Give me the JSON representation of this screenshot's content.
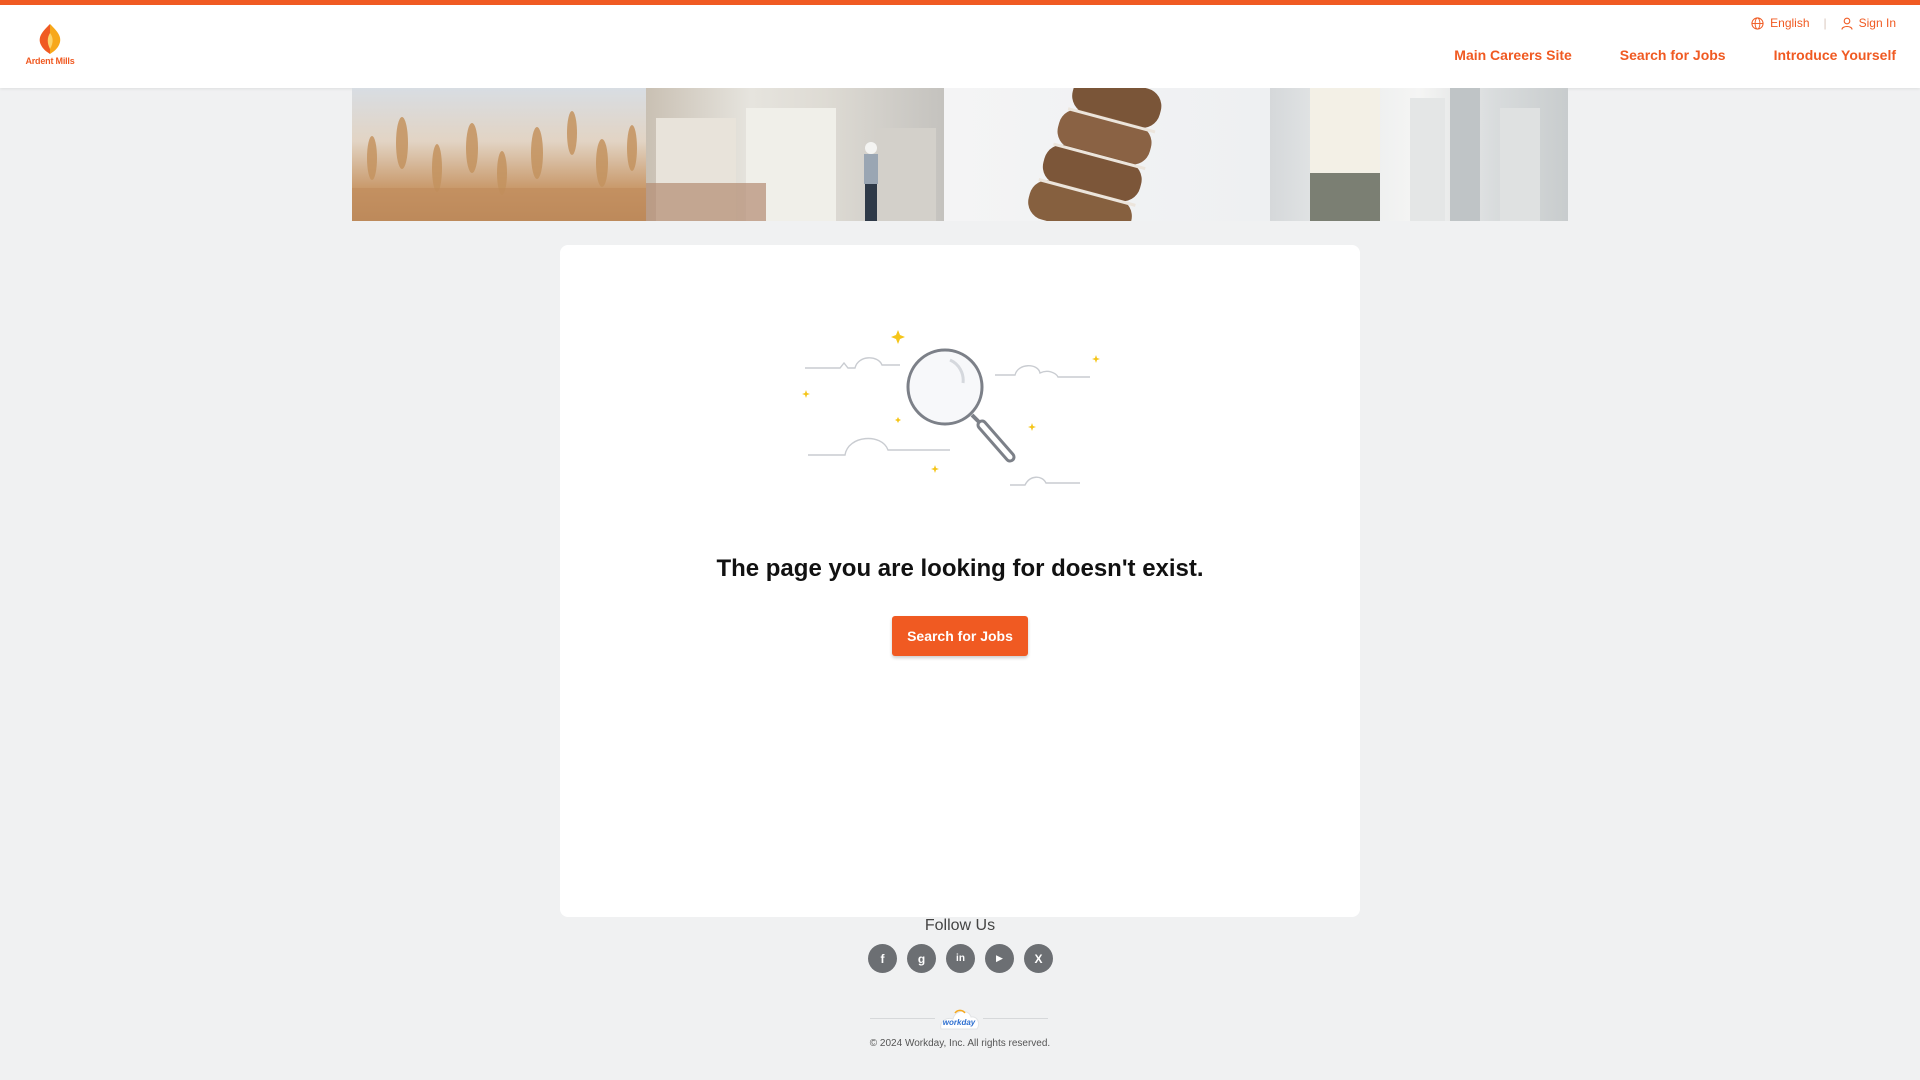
{
  "colors": {
    "brand": "#f05a22",
    "background": "#f0f1f2",
    "card": "#ffffff"
  },
  "header": {
    "logo": {
      "text": "Ardent Mills",
      "icon": "ardent-mills-flame-logo"
    },
    "utility": {
      "language": {
        "label": "English",
        "icon": "globe-icon"
      },
      "sign_in": {
        "label": "Sign In",
        "icon": "user-icon"
      }
    },
    "nav": [
      {
        "label": "Main Careers Site"
      },
      {
        "label": "Search for Jobs"
      },
      {
        "label": "Introduce Yourself"
      }
    ]
  },
  "hero": {
    "images": [
      "wheat-field-photo",
      "mill-worker-photo",
      "sliced-bread-photo",
      "flour-tubes-photo"
    ]
  },
  "main": {
    "illustration": "magnifying-glass-clouds-illustration",
    "message": "The page you are looking for doesn't exist.",
    "button_label": "Search for Jobs"
  },
  "footer": {
    "follow_label": "Follow Us",
    "socials": [
      {
        "name": "facebook",
        "glyph": "f"
      },
      {
        "name": "glassdoor",
        "glyph": "g"
      },
      {
        "name": "linkedin",
        "glyph": "in"
      },
      {
        "name": "youtube",
        "glyph": "▶"
      },
      {
        "name": "x",
        "glyph": "X"
      }
    ],
    "workday_text": "workday",
    "copyright": "© 2024 Workday, Inc. All rights reserved."
  }
}
